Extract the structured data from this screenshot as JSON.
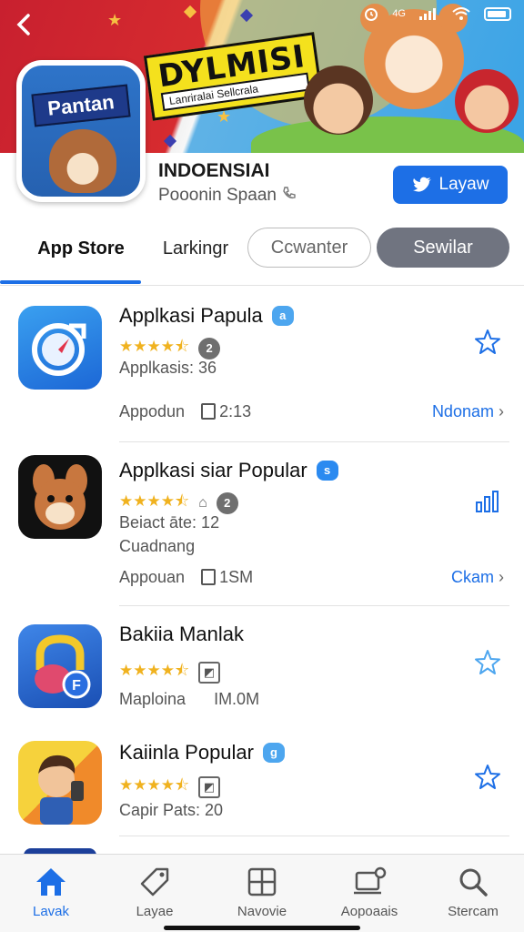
{
  "status_bar": {
    "signal": "4G"
  },
  "banner": {
    "title": "DYLMISI",
    "subtitle": "Lanriralai Sellcrala"
  },
  "app": {
    "icon_text": "Pantan",
    "name": "INDOENSIAI",
    "developer": "Pooonin Spaan",
    "action_button": "Layaw"
  },
  "tabs": [
    {
      "label": "App Store",
      "active": true
    },
    {
      "label": "Larkingr"
    },
    {
      "label": "Ccwanter"
    },
    {
      "label": "Sewilar"
    }
  ],
  "apps": [
    {
      "title": "Applkasi Papula",
      "badge": "a",
      "mini_icon": "2",
      "sub1": "Applkasis: 36",
      "meta_left": "Appodun",
      "meta_right": "2:13",
      "link": "Ndonam",
      "right_icon": "star-outline-icon",
      "rating": 4.5
    },
    {
      "title": "Applkasi siar Popular",
      "badge": "s",
      "mini_icon": "2",
      "sub1": "Beiact āte: 12",
      "sub2": "Cuadnang",
      "meta_left": "Appouan",
      "meta_right": "1SM",
      "link": "Ckam",
      "right_icon": "bar-chart-icon",
      "rating": 4.5
    },
    {
      "title": "Bakiia Manlak",
      "sub1": "Maploina",
      "sub1_right": "IM.0M",
      "right_icon": "star-outline-icon",
      "rating": 4.5
    },
    {
      "title": "Kaiinla Popular",
      "badge": "g",
      "sub1": "Capir Pats: 20",
      "right_icon": "star-outline-icon",
      "rating": 4.5
    }
  ],
  "bottom_nav": [
    {
      "label": "Lavak",
      "icon": "home-icon",
      "active": true
    },
    {
      "label": "Layae",
      "icon": "tag-icon"
    },
    {
      "label": "Navovie",
      "icon": "grid-icon"
    },
    {
      "label": "Aopoaais",
      "icon": "device-icon"
    },
    {
      "label": "Stercam",
      "icon": "search-icon"
    }
  ],
  "colors": {
    "accent": "#1d6fe6",
    "star": "#f0b21f",
    "banner_red": "#c8202f",
    "banner_blue": "#3aa3e6"
  }
}
